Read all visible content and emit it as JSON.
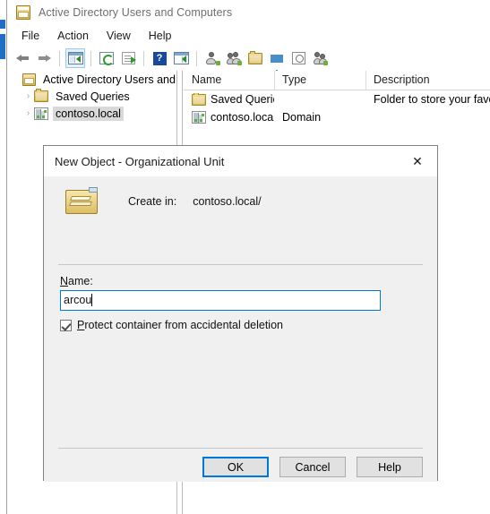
{
  "window": {
    "title": "Active Directory Users and Computers",
    "icon": "mmc-console-icon",
    "menu": [
      "File",
      "Action",
      "View",
      "Help"
    ],
    "toolbar": [
      {
        "name": "back-button",
        "icon": "arrow-left-icon"
      },
      {
        "name": "forward-button",
        "icon": "arrow-right-icon"
      },
      {
        "name": "show-hide-console-tree-button",
        "icon": "console-tree-icon",
        "selected": true
      },
      {
        "name": "refresh-button",
        "icon": "refresh-icon"
      },
      {
        "name": "export-list-button",
        "icon": "export-list-icon"
      },
      {
        "name": "help-button",
        "icon": "help-question-icon"
      },
      {
        "name": "show-action-pane-button",
        "icon": "action-pane-icon"
      },
      {
        "name": "new-user-button",
        "icon": "new-user-icon"
      },
      {
        "name": "new-group-button",
        "icon": "new-group-icon"
      },
      {
        "name": "new-contact-button",
        "icon": "new-contact-icon"
      },
      {
        "name": "filter-button",
        "icon": "filter-funnel-icon"
      },
      {
        "name": "find-button",
        "icon": "find-magnifier-icon"
      },
      {
        "name": "new-computer-button",
        "icon": "new-computer-icon"
      }
    ]
  },
  "tree": {
    "root": {
      "label": "Active Directory Users and Com",
      "icon": "console-root-icon"
    },
    "items": [
      {
        "label": "Saved Queries",
        "icon": "folder-icon",
        "expander": "›",
        "selected": false
      },
      {
        "label": "contoso.local",
        "icon": "domain-icon",
        "expander": "›",
        "selected": true
      }
    ]
  },
  "list": {
    "columns": [
      "Name",
      "Type",
      "Description"
    ],
    "rows": [
      {
        "name": "Saved Queries",
        "icon": "folder-icon",
        "type": "",
        "description": "Folder to store your favo..."
      },
      {
        "name": "contoso.local",
        "icon": "domain-icon",
        "type": "Domain",
        "description": ""
      }
    ]
  },
  "dialog": {
    "title": "New Object - Organizational Unit",
    "close_label": "✕",
    "icon": "organizational-unit-icon",
    "create_in_label": "Create in:",
    "create_in_value": "contoso.local/",
    "name_label": "Name:",
    "name_label_accel": "N",
    "name_value": "arcou",
    "name_placeholder": "",
    "protect_checkbox_label": "Protect container from accidental deletion",
    "protect_checkbox_accel": "P",
    "protect_checked": true,
    "buttons": [
      {
        "label": "OK",
        "default": true
      },
      {
        "label": "Cancel",
        "default": false
      },
      {
        "label": "Help",
        "default": false
      }
    ]
  },
  "colors": {
    "accent": "#0078d7",
    "dialog_bg": "#f0f0f0",
    "selection": "#d9d9d9"
  }
}
